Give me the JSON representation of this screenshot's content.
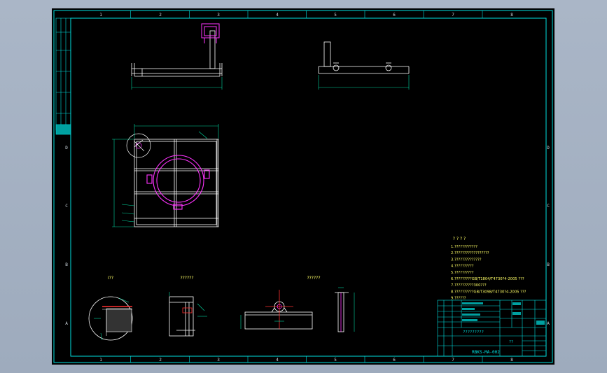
{
  "column_marks": [
    "1",
    "2",
    "3",
    "4",
    "5",
    "6",
    "7",
    "8"
  ],
  "row_marks": [
    "D",
    "C",
    "B",
    "A"
  ],
  "view_labels": {
    "detail_a": "I??",
    "section_1": "??????",
    "section_2": "??????"
  },
  "notes": {
    "heading": "? ? ? ?",
    "lines": [
      "1.????????????",
      "2.??????????????????",
      "3.??????????????",
      "4.??????????",
      "5.??????????",
      "6.?????????GB/T1804/T4730?4-2005 ???",
      "7.??????????300???",
      "8.??????????GB/T3098/T4730?4-2005 ???",
      "9.??????"
    ]
  },
  "title_block": {
    "title": "?????????",
    "drawing_no": "RBKS-MA-002",
    "scale": "??"
  },
  "colors": {
    "sheet_bg": "#000000",
    "border": "#00e0e0",
    "part": "#ffffff",
    "dimension": "#00d8a0",
    "highlight": "#ff33ff",
    "notes": "#ffff66",
    "redline": "#ff3030"
  }
}
